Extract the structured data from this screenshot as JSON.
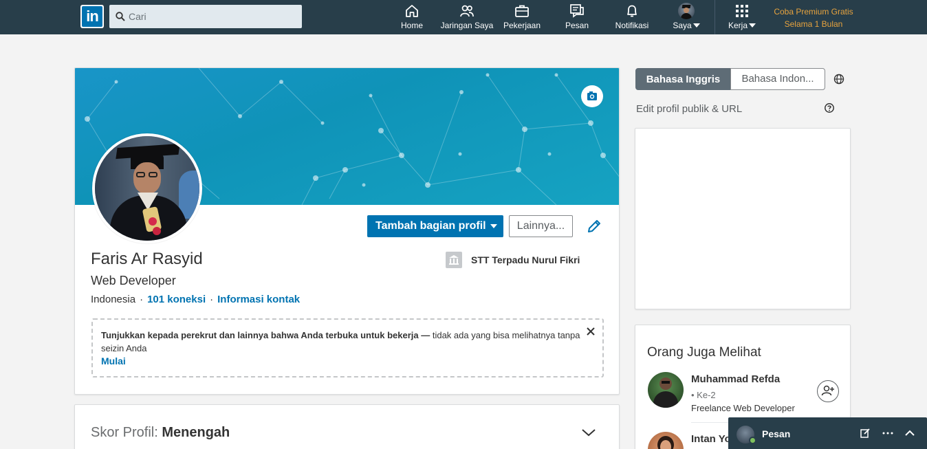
{
  "nav": {
    "logo_text": "in",
    "search_placeholder": "Cari",
    "items": [
      {
        "label": "Home",
        "icon": "home-icon"
      },
      {
        "label": "Jaringan Saya",
        "icon": "network-icon"
      },
      {
        "label": "Pekerjaan",
        "icon": "briefcase-icon"
      },
      {
        "label": "Pesan",
        "icon": "messages-icon"
      },
      {
        "label": "Notifikasi",
        "icon": "bell-icon"
      },
      {
        "label": "Saya",
        "icon": "avatar"
      },
      {
        "label": "Kerja",
        "icon": "grid-icon"
      }
    ],
    "premium_line1": "Coba Premium Gratis",
    "premium_line2": "Selama 1 Bulan"
  },
  "profile": {
    "name": "Faris Ar Rasyid",
    "headline": "Web Developer",
    "location": "Indonesia",
    "connections": "101 koneksi",
    "contact_info": "Informasi kontak",
    "school": "STT Terpadu Nurul Fikri",
    "add_section_label": "Tambah bagian profil",
    "more_label": "Lainnya...",
    "open_to_bold": "Tunjukkan kepada perekrut dan lainnya bahwa Anda terbuka untuk bekerja —",
    "open_to_rest": " tidak ada yang bisa melihatnya tanpa seizin Anda",
    "open_to_cta": "Mulai"
  },
  "score": {
    "label": "Skor Profil: ",
    "value": "Menengah"
  },
  "sidebar": {
    "lang_active": "Bahasa Inggris",
    "lang_inactive": "Bahasa Indon...",
    "edit_public": "Edit profil publik & URL",
    "people_title": "Orang Juga Melihat",
    "people": [
      {
        "name": "Muhammad Refda",
        "degree": "• Ke-2",
        "job": "Freelance Web Developer"
      },
      {
        "name": "Intan Yo",
        "degree": "",
        "job": ""
      }
    ]
  },
  "messaging": {
    "title": "Pesan"
  },
  "colors": {
    "nav_bg": "#283e4a",
    "brand_blue": "#0073b1",
    "premium_gold": "#e7a33e"
  }
}
